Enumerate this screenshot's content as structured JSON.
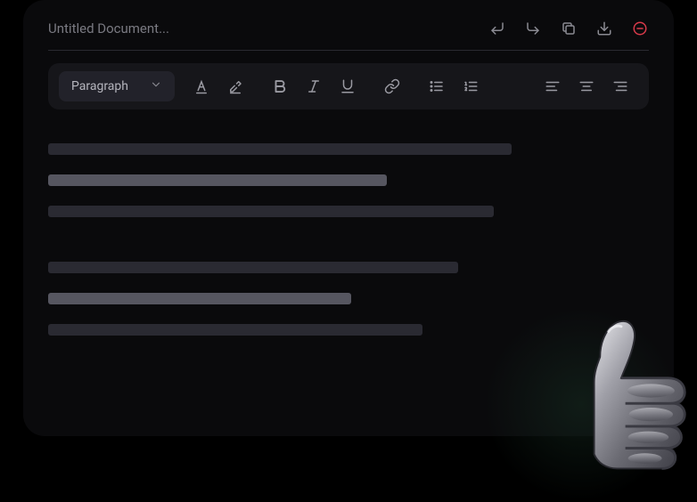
{
  "header": {
    "title": "Untitled Document..."
  },
  "toolbar": {
    "paragraph_label": "Paragraph"
  }
}
